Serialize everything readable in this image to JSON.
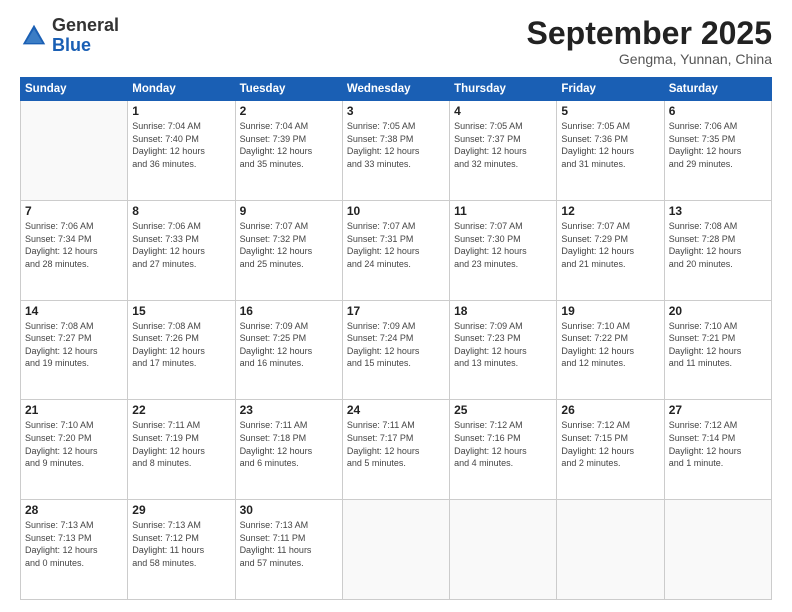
{
  "header": {
    "logo_general": "General",
    "logo_blue": "Blue",
    "month_title": "September 2025",
    "location": "Gengma, Yunnan, China"
  },
  "weekdays": [
    "Sunday",
    "Monday",
    "Tuesday",
    "Wednesday",
    "Thursday",
    "Friday",
    "Saturday"
  ],
  "weeks": [
    [
      {
        "day": "",
        "info": ""
      },
      {
        "day": "1",
        "info": "Sunrise: 7:04 AM\nSunset: 7:40 PM\nDaylight: 12 hours\nand 36 minutes."
      },
      {
        "day": "2",
        "info": "Sunrise: 7:04 AM\nSunset: 7:39 PM\nDaylight: 12 hours\nand 35 minutes."
      },
      {
        "day": "3",
        "info": "Sunrise: 7:05 AM\nSunset: 7:38 PM\nDaylight: 12 hours\nand 33 minutes."
      },
      {
        "day": "4",
        "info": "Sunrise: 7:05 AM\nSunset: 7:37 PM\nDaylight: 12 hours\nand 32 minutes."
      },
      {
        "day": "5",
        "info": "Sunrise: 7:05 AM\nSunset: 7:36 PM\nDaylight: 12 hours\nand 31 minutes."
      },
      {
        "day": "6",
        "info": "Sunrise: 7:06 AM\nSunset: 7:35 PM\nDaylight: 12 hours\nand 29 minutes."
      }
    ],
    [
      {
        "day": "7",
        "info": "Sunrise: 7:06 AM\nSunset: 7:34 PM\nDaylight: 12 hours\nand 28 minutes."
      },
      {
        "day": "8",
        "info": "Sunrise: 7:06 AM\nSunset: 7:33 PM\nDaylight: 12 hours\nand 27 minutes."
      },
      {
        "day": "9",
        "info": "Sunrise: 7:07 AM\nSunset: 7:32 PM\nDaylight: 12 hours\nand 25 minutes."
      },
      {
        "day": "10",
        "info": "Sunrise: 7:07 AM\nSunset: 7:31 PM\nDaylight: 12 hours\nand 24 minutes."
      },
      {
        "day": "11",
        "info": "Sunrise: 7:07 AM\nSunset: 7:30 PM\nDaylight: 12 hours\nand 23 minutes."
      },
      {
        "day": "12",
        "info": "Sunrise: 7:07 AM\nSunset: 7:29 PM\nDaylight: 12 hours\nand 21 minutes."
      },
      {
        "day": "13",
        "info": "Sunrise: 7:08 AM\nSunset: 7:28 PM\nDaylight: 12 hours\nand 20 minutes."
      }
    ],
    [
      {
        "day": "14",
        "info": "Sunrise: 7:08 AM\nSunset: 7:27 PM\nDaylight: 12 hours\nand 19 minutes."
      },
      {
        "day": "15",
        "info": "Sunrise: 7:08 AM\nSunset: 7:26 PM\nDaylight: 12 hours\nand 17 minutes."
      },
      {
        "day": "16",
        "info": "Sunrise: 7:09 AM\nSunset: 7:25 PM\nDaylight: 12 hours\nand 16 minutes."
      },
      {
        "day": "17",
        "info": "Sunrise: 7:09 AM\nSunset: 7:24 PM\nDaylight: 12 hours\nand 15 minutes."
      },
      {
        "day": "18",
        "info": "Sunrise: 7:09 AM\nSunset: 7:23 PM\nDaylight: 12 hours\nand 13 minutes."
      },
      {
        "day": "19",
        "info": "Sunrise: 7:10 AM\nSunset: 7:22 PM\nDaylight: 12 hours\nand 12 minutes."
      },
      {
        "day": "20",
        "info": "Sunrise: 7:10 AM\nSunset: 7:21 PM\nDaylight: 12 hours\nand 11 minutes."
      }
    ],
    [
      {
        "day": "21",
        "info": "Sunrise: 7:10 AM\nSunset: 7:20 PM\nDaylight: 12 hours\nand 9 minutes."
      },
      {
        "day": "22",
        "info": "Sunrise: 7:11 AM\nSunset: 7:19 PM\nDaylight: 12 hours\nand 8 minutes."
      },
      {
        "day": "23",
        "info": "Sunrise: 7:11 AM\nSunset: 7:18 PM\nDaylight: 12 hours\nand 6 minutes."
      },
      {
        "day": "24",
        "info": "Sunrise: 7:11 AM\nSunset: 7:17 PM\nDaylight: 12 hours\nand 5 minutes."
      },
      {
        "day": "25",
        "info": "Sunrise: 7:12 AM\nSunset: 7:16 PM\nDaylight: 12 hours\nand 4 minutes."
      },
      {
        "day": "26",
        "info": "Sunrise: 7:12 AM\nSunset: 7:15 PM\nDaylight: 12 hours\nand 2 minutes."
      },
      {
        "day": "27",
        "info": "Sunrise: 7:12 AM\nSunset: 7:14 PM\nDaylight: 12 hours\nand 1 minute."
      }
    ],
    [
      {
        "day": "28",
        "info": "Sunrise: 7:13 AM\nSunset: 7:13 PM\nDaylight: 12 hours\nand 0 minutes."
      },
      {
        "day": "29",
        "info": "Sunrise: 7:13 AM\nSunset: 7:12 PM\nDaylight: 11 hours\nand 58 minutes."
      },
      {
        "day": "30",
        "info": "Sunrise: 7:13 AM\nSunset: 7:11 PM\nDaylight: 11 hours\nand 57 minutes."
      },
      {
        "day": "",
        "info": ""
      },
      {
        "day": "",
        "info": ""
      },
      {
        "day": "",
        "info": ""
      },
      {
        "day": "",
        "info": ""
      }
    ]
  ]
}
